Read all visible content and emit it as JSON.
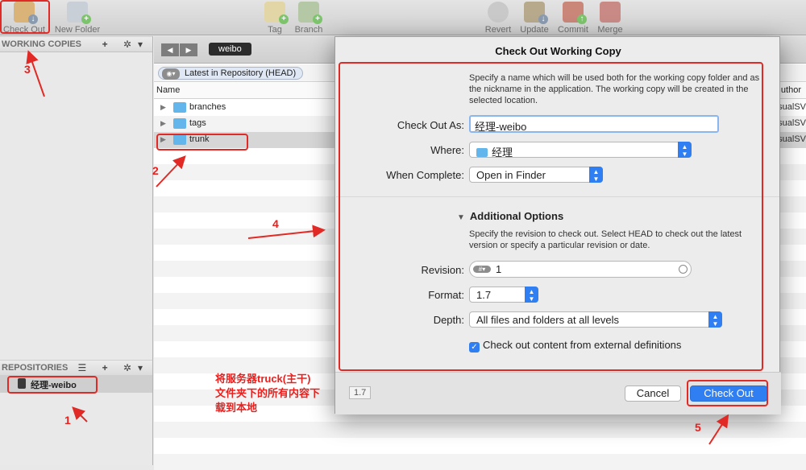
{
  "toolbar": {
    "checkout_label": "Check Out",
    "new_folder_label": "New Folder",
    "tag_label": "Tag",
    "branch_label": "Branch",
    "revert_label": "Revert",
    "update_label": "Update",
    "commit_label": "Commit",
    "merge_label": "Merge"
  },
  "sidebar": {
    "working_copies_header": "WORKING COPIES",
    "repositories_header": "REPOSITORIES",
    "repo_item": "经理-weibo",
    "header_buttons": "+ ✲▾",
    "repo_header_buttons": "☰ + ✲▾"
  },
  "main": {
    "back": "◀",
    "forward": "▶",
    "path": "weibo",
    "revision_selector": "Latest in Repository (HEAD)",
    "revision_icon": "◉▾",
    "col_name": "Name",
    "col_author": "uthor",
    "rows": [
      {
        "name": "branches",
        "author": "sualSV"
      },
      {
        "name": "tags",
        "author": "sualSV"
      },
      {
        "name": "trunk",
        "author": "sualSV"
      }
    ]
  },
  "dialog": {
    "title": "Check Out Working Copy",
    "desc": "Specify a name which will be used both for the working copy folder and as the nickname in the application. The working copy will be created in the selected location.",
    "checkout_as_label": "Check Out As:",
    "checkout_as_value": "经理-weibo",
    "where_label": "Where:",
    "where_value": "经理",
    "when_complete_label": "When Complete:",
    "when_complete_value": "Open in Finder",
    "additional_options": "Additional Options",
    "options_desc": "Specify the revision to check out. Select HEAD to check out the latest version or specify a particular revision or date.",
    "revision_label": "Revision:",
    "revision_value": "1",
    "revision_mode": "#▾",
    "format_label": "Format:",
    "format_value": "1.7",
    "depth_label": "Depth:",
    "depth_value": "All files and folders at all levels",
    "externals_label": "Check out content from external definitions",
    "externals_checked": true,
    "version_badge": "1.7",
    "cancel_label": "Cancel",
    "checkout_label": "Check Out"
  },
  "annotations": {
    "n1": "1",
    "n2": "2",
    "n3": "3",
    "n4": "4",
    "n5": "5",
    "note_line1": "将服务器truck(主干)",
    "note_line2": "文件夹下的所有内容下",
    "note_line3": "载到本地"
  },
  "colors": {
    "accent": "#2f7ff2",
    "annotation": "#e12a25",
    "folder": "#62b6ec"
  }
}
